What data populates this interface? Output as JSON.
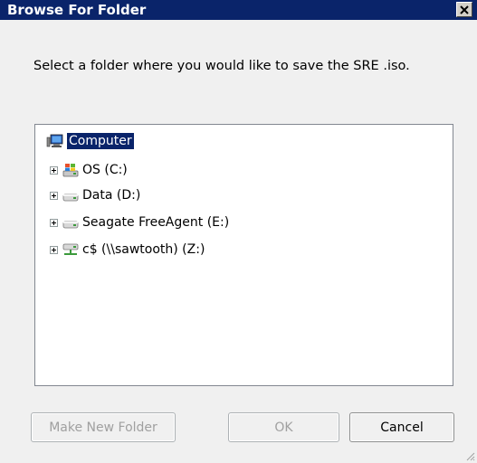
{
  "window": {
    "title": "Browse For Folder",
    "close_glyph": "✕"
  },
  "instruction": "Select a folder where you would like to save the SRE .iso.",
  "tree": {
    "nodes": [
      {
        "label": "Computer",
        "icon": "computer-icon",
        "selected": true,
        "expandable": false
      },
      {
        "label": "OS (C:)",
        "icon": "os-drive-icon",
        "selected": false,
        "expandable": true
      },
      {
        "label": "Data (D:)",
        "icon": "drive-icon",
        "selected": false,
        "expandable": true
      },
      {
        "label": "Seagate FreeAgent (E:)",
        "icon": "drive-icon",
        "selected": false,
        "expandable": true
      },
      {
        "label": "c$ (\\\\sawtooth) (Z:)",
        "icon": "network-drive-icon",
        "selected": false,
        "expandable": true
      }
    ]
  },
  "buttons": {
    "new_folder": "Make New Folder",
    "ok": "OK",
    "cancel": "Cancel"
  },
  "colors": {
    "titlebar": "#0a246a",
    "selection": "#0a246a",
    "dialog_bg": "#f0f0f0"
  }
}
